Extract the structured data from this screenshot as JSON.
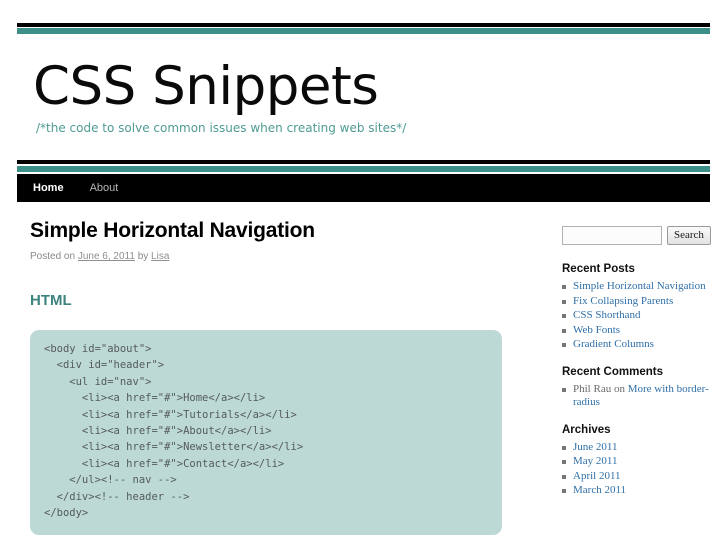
{
  "site": {
    "title": "CSS Snippets",
    "tagline": "/*the code to solve common issues when creating web sites*/"
  },
  "nav": {
    "items": [
      {
        "label": "Home",
        "current": true
      },
      {
        "label": "About",
        "current": false
      }
    ]
  },
  "post": {
    "title": "Simple Horizontal Navigation",
    "meta_prefix": "Posted on",
    "date": "June 6, 2011",
    "meta_by": "by",
    "author": "Lisa",
    "section_heading": "HTML",
    "code": "<body id=\"about\">\n  <div id=\"header\">\n    <ul id=\"nav\">\n      <li><a href=\"#\">Home</a></li>\n      <li><a href=\"#\">Tutorials</a></li>\n      <li><a href=\"#\">About</a></li>\n      <li><a href=\"#\">Newsletter</a></li>\n      <li><a href=\"#\">Contact</a></li>\n    </ul><!-- nav -->\n  </div><!-- header -->\n</body>"
  },
  "sidebar": {
    "search": {
      "value": "",
      "placeholder": "",
      "button_label": "Search"
    },
    "recent_posts": {
      "title": "Recent Posts",
      "items": [
        "Simple Horizontal Navigation",
        "Fix Collapsing Parents",
        "CSS Shorthand",
        "Web Fonts",
        "Gradient Columns"
      ]
    },
    "recent_comments": {
      "title": "Recent Comments",
      "items": [
        {
          "author": "Phil Rau",
          "on": "on",
          "post": "More with border-radius"
        }
      ]
    },
    "archives": {
      "title": "Archives",
      "items": [
        "June 2011",
        "May 2011",
        "April 2011",
        "March 2011"
      ]
    }
  },
  "colors": {
    "accent_teal": "#3d8f8a",
    "code_bg": "#bcd9d5",
    "link_blue": "#2f6fa8",
    "nav_bg": "#000000"
  }
}
